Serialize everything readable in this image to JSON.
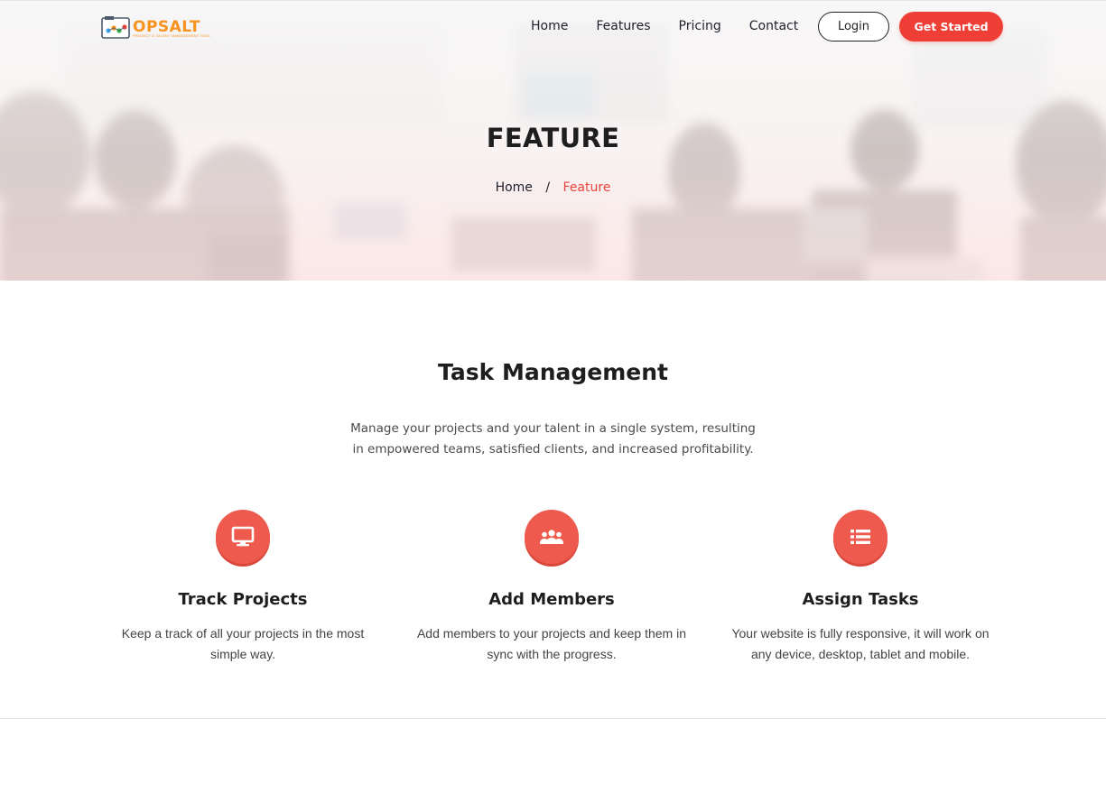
{
  "brand": {
    "name": "OPSALT",
    "tagline": "PROJECT & TALENT MANAGEMENT TOOL"
  },
  "nav": {
    "links": [
      "Home",
      "Features",
      "Pricing",
      "Contact"
    ],
    "login_label": "Login",
    "cta_label": "Get Started"
  },
  "hero": {
    "title": "FEATURE",
    "breadcrumb": {
      "home": "Home",
      "separator": "/",
      "current": "Feature"
    }
  },
  "section": {
    "title": "Task Management",
    "description": "Manage your projects and your talent in a single system, resulting in empowered teams, satisfied clients, and increased profitability."
  },
  "features": [
    {
      "icon": "desktop-icon",
      "title": "Track Projects",
      "description": "Keep a track of all your projects in the most simple way."
    },
    {
      "icon": "users-icon",
      "title": "Add Members",
      "description": "Add members to your projects and keep them in sync with the progress."
    },
    {
      "icon": "list-icon",
      "title": "Assign Tasks",
      "description": "Your website is fully responsive, it will work on any device, desktop, tablet and mobile."
    }
  ],
  "colors": {
    "accent": "#ef3e36",
    "icon_bg": "#ee5b4e",
    "breadcrumb_active": "#e8453c",
    "logo": "#f7931e"
  }
}
